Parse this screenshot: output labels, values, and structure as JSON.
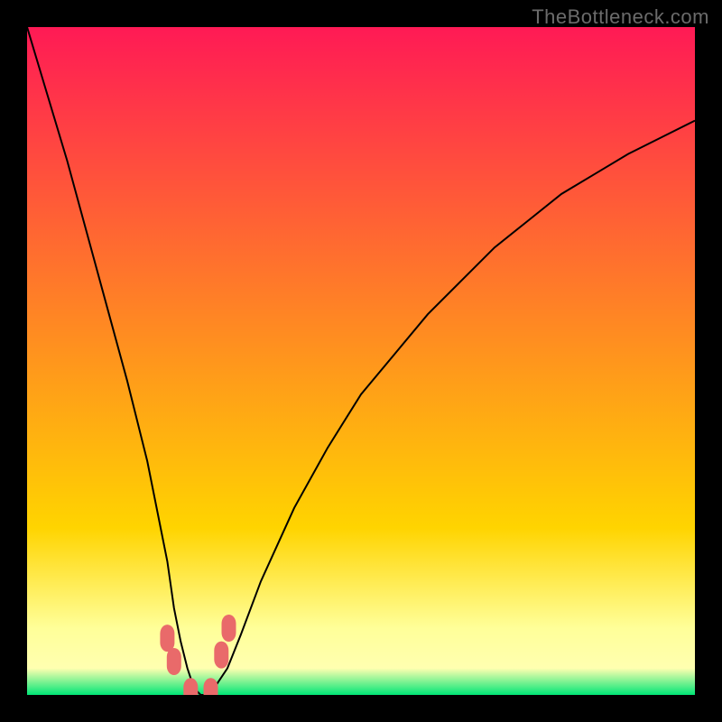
{
  "watermark": "TheBottleneck.com",
  "colors": {
    "page_bg": "#000000",
    "grad_top": "#ff1a55",
    "grad_yellow": "#ffd400",
    "grad_paleyellow": "#ffff99",
    "grad_green": "#00e676",
    "curve": "#000000",
    "marker": "#e96a6a"
  },
  "chart_data": {
    "type": "line",
    "title": "",
    "xlabel": "",
    "ylabel": "",
    "xlim": [
      0,
      100
    ],
    "ylim": [
      0,
      100
    ],
    "x": [
      0,
      3,
      6,
      9,
      12,
      15,
      18,
      21,
      22,
      23,
      24,
      25,
      26,
      27,
      28,
      30,
      32,
      35,
      40,
      45,
      50,
      55,
      60,
      65,
      70,
      75,
      80,
      85,
      90,
      95,
      100
    ],
    "y": [
      100,
      90,
      80,
      69,
      58,
      47,
      35,
      20,
      13,
      8,
      4,
      1,
      0,
      0,
      1,
      4,
      9,
      17,
      28,
      37,
      45,
      51,
      57,
      62,
      67,
      71,
      75,
      78,
      81,
      83.5,
      86
    ],
    "markers": {
      "x": [
        21.0,
        22.0,
        24.5,
        27.5,
        29.1,
        30.2
      ],
      "y": [
        8.5,
        5.0,
        0.5,
        0.5,
        6.0,
        10.0
      ]
    },
    "background_bands": [
      {
        "start": 100,
        "end": 25,
        "from": "#ff1a55",
        "to": "#ffd400"
      },
      {
        "start": 25,
        "end": 10,
        "from": "#ffd400",
        "to": "#ffff99"
      },
      {
        "start": 10,
        "end": 4,
        "from": "#ffff99",
        "to": "#ffffb0"
      },
      {
        "start": 4,
        "end": 0,
        "from": "#ffffb0",
        "to": "#00e676"
      }
    ]
  }
}
